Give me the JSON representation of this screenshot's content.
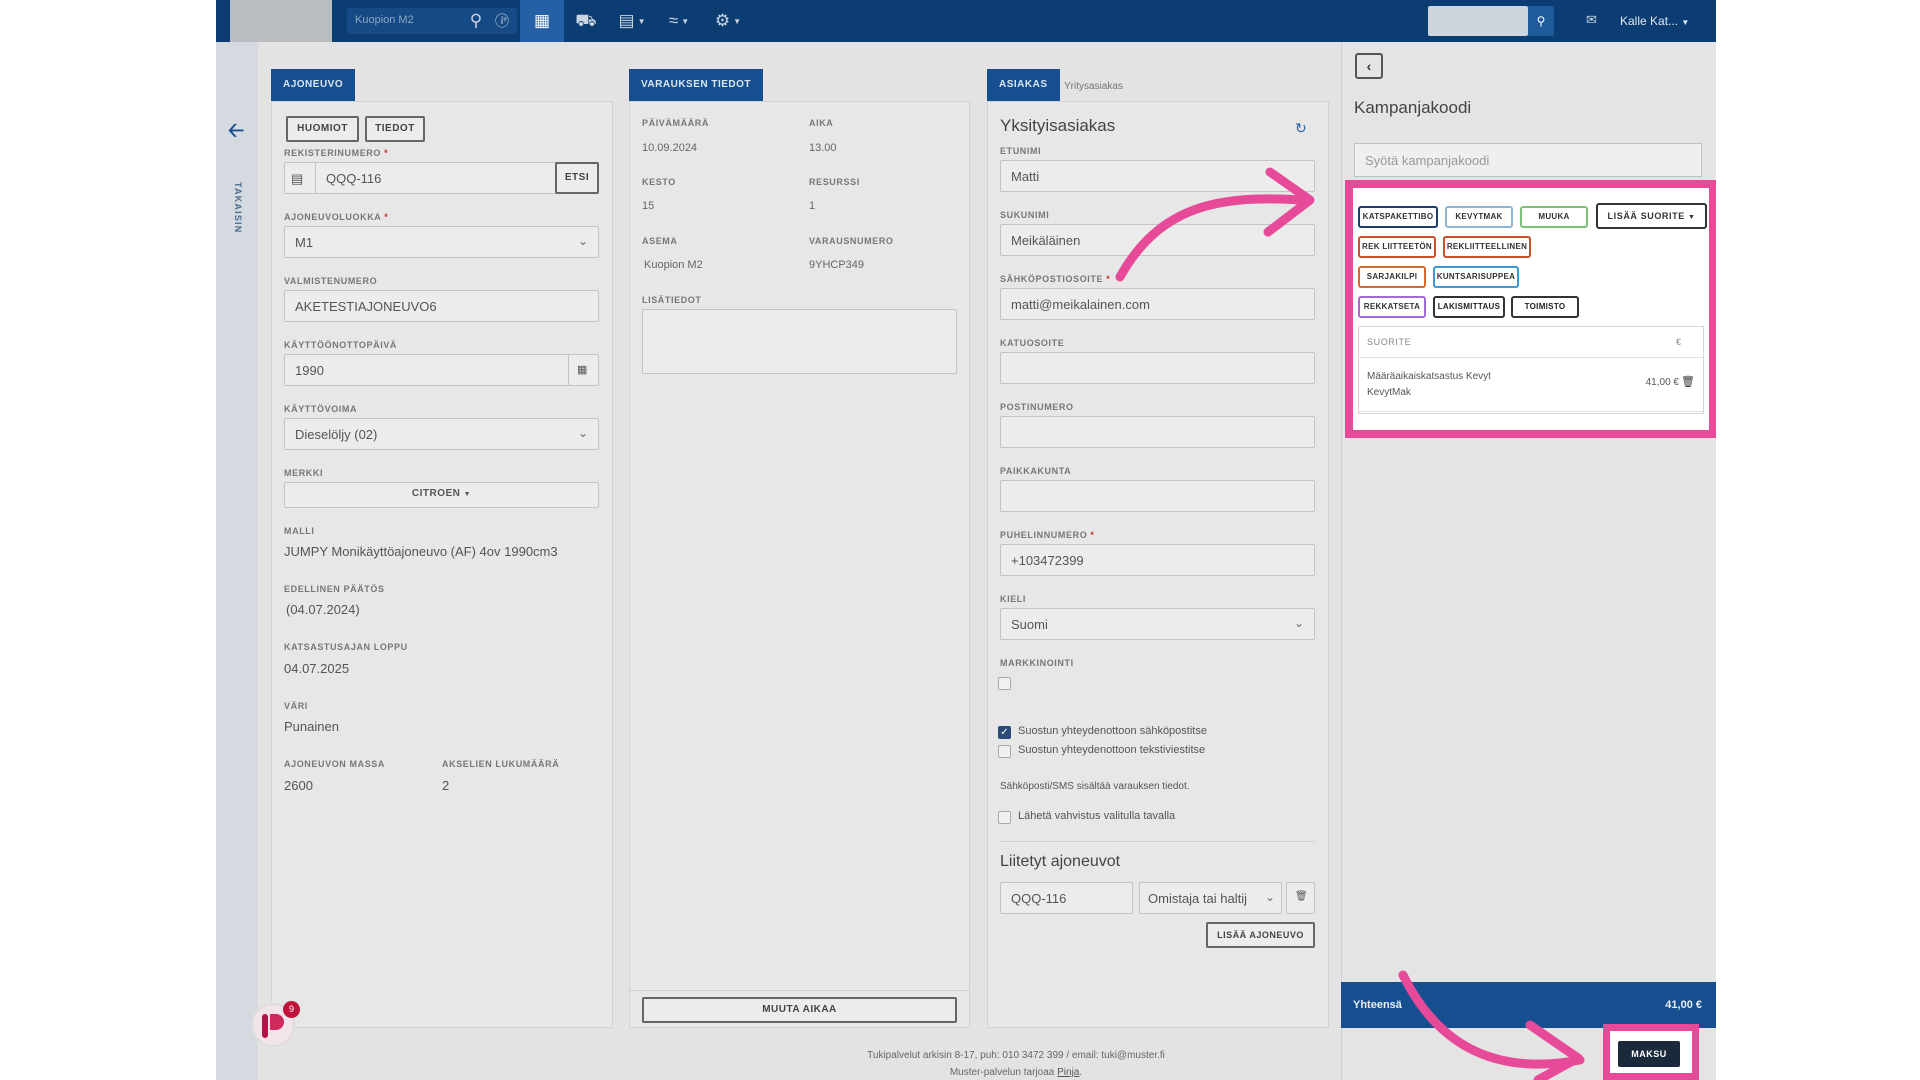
{
  "topbar": {
    "location": "Kuopion M2",
    "user": "Kalle Kat..."
  },
  "back": {
    "label": "TAKAISIN"
  },
  "vehicle": {
    "tab": "AJONEUVO",
    "notes_btn": "HUOMIOT",
    "info_btn": "TIEDOT",
    "reg_label": "REKISTERINUMERO",
    "reg_value": "QQQ-116",
    "search_btn": "ETSI",
    "class_label": "AJONEUVOLUOKKA",
    "class_value": "M1",
    "vin_label": "VALMISTENUMERO",
    "vin_value": "AKETESTIAJONEUVO6",
    "reg_date_label": "KÄYTTÖÖNOTTOPÄIVÄ",
    "reg_date_value": "1990",
    "fuel_label": "KÄYTTÖVOIMA",
    "fuel_value": "Dieselöljy (02)",
    "make_label": "MERKKI",
    "make_value": "CITROEN",
    "model_label": "MALLI",
    "model_value": "JUMPY Monikäyttöajoneuvo (AF) 4ov 1990cm3",
    "prev_label": "EDELLINEN PÄÄTÖS",
    "prev_value": "(04.07.2024)",
    "end_label": "KATSASTUSAJAN LOPPU",
    "end_value": "04.07.2025",
    "color_label": "VÄRI",
    "color_value": "Punainen",
    "mass_label": "AJONEUVON MASSA",
    "mass_value": "2600",
    "axles_label": "AKSELIEN LUKUMÄÄRÄ",
    "axles_value": "2"
  },
  "reservation": {
    "tab": "VARAUKSEN TIEDOT",
    "date_label": "PÄIVÄMÄÄRÄ",
    "date_value": "10.09.2024",
    "time_label": "AIKA",
    "time_value": "13.00",
    "duration_label": "KESTO",
    "duration_value": "15",
    "resource_label": "RESURSSI",
    "resource_value": "1",
    "station_label": "ASEMA",
    "station_value": "Kuopion M2",
    "number_label": "VARAUSNUMERO",
    "number_value": "9YHCP349",
    "extra_label": "LISÄTIEDOT",
    "change_time_btn": "MUUTA AIKAA"
  },
  "customer": {
    "tab": "ASIAKAS",
    "subtab": "Yritysasiakas",
    "heading": "Yksityisasiakas",
    "first_label": "ETUNIMI",
    "first_value": "Matti",
    "last_label": "SUKUNIMI",
    "last_value": "Meikäläinen",
    "email_label": "SÄHKÖPOSTIOSOITE",
    "email_value": "matti@meikalainen.com",
    "street_label": "KATUOSOITE",
    "zip_label": "POSTINUMERO",
    "city_label": "PAIKKAKUNTA",
    "phone_label": "PUHELINNUMERO",
    "phone_value": "+103472399",
    "lang_label": "KIELI",
    "lang_value": "Suomi",
    "marketing_label": "MARKKINOINTI",
    "consent_email": "Suostun yhteydenottoon sähköpostitse",
    "consent_sms": "Suostun yhteydenottoon tekstiviestitse",
    "info_text": "Sähköposti/SMS sisältää varauksen tiedot.",
    "confirm_text": "Lähetä vahvistus valitulla tavalla",
    "linked_heading": "Liitetyt ajoneuvot",
    "linked_reg": "QQQ-116",
    "linked_role": "Omistaja tai haltij",
    "add_vehicle_btn": "LISÄÄ AJONEUVO"
  },
  "campaign": {
    "title": "Kampanjakoodi",
    "placeholder": "Syötä kampanjakoodi"
  },
  "services": {
    "chips": [
      {
        "label": "KATSPAKETTIBO",
        "color": "#1f3d6b"
      },
      {
        "label": "KEVYTMAK",
        "color": "#8db6d6"
      },
      {
        "label": "MUUKA",
        "color": "#7ac27a"
      },
      {
        "label": "REK LIITTEETÖN",
        "color": "#c8502c"
      },
      {
        "label": "REKLIITTEELLINEN",
        "color": "#c8502c"
      },
      {
        "label": "SARJAKILPI",
        "color": "#d66a2a"
      },
      {
        "label": "KUNTSARISUPPEA",
        "color": "#3c9bd6"
      },
      {
        "label": "REKKATSETA",
        "color": "#a36ad0"
      },
      {
        "label": "LAKISMITTAUS",
        "color": "#333333"
      },
      {
        "label": "TOIMISTO",
        "color": "#333333"
      }
    ],
    "add_btn": "LISÄÄ SUORITE",
    "table_header": "SUORITE",
    "currency_header": "€",
    "row_name_1": "Määräaikaiskatsastus Kevyt",
    "row_name_2": "KevytMak",
    "row_price": "41,00 €"
  },
  "total": {
    "label": "Yhteensä",
    "value": "41,00 €",
    "pay_btn": "MAKSU"
  },
  "footer": {
    "line1": "Tukipalvelut arkisin 8-17, puh: 010 3472 399 / email: tuki@muster.fi",
    "line2_prefix": "Muster-palvelun tarjoaa ",
    "line2_link": "Pinja",
    "line2_suffix": "."
  },
  "chat": {
    "badge": "9"
  },
  "colors": {
    "brand": "#154f8f",
    "highlight": "#e84a9a"
  }
}
